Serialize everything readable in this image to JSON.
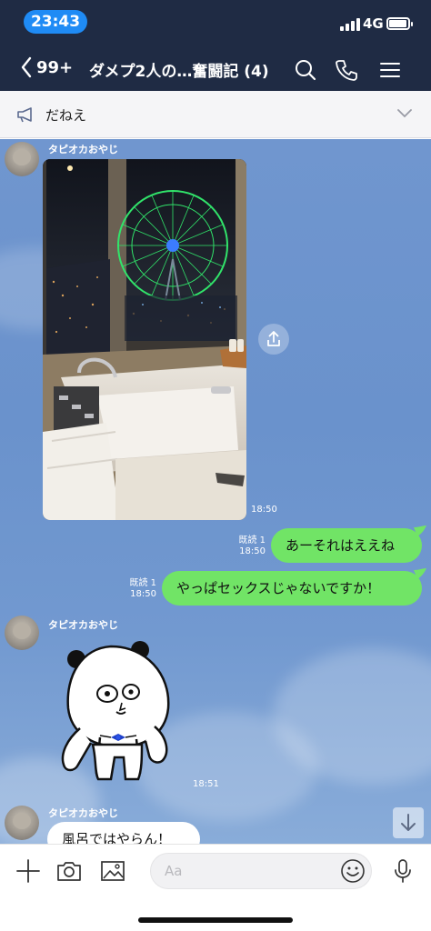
{
  "status_bar": {
    "time": "23:43",
    "network": "4G"
  },
  "header": {
    "back_count": "99+",
    "title": "ダメプ2人の…奮闘記 (4)"
  },
  "announcement": {
    "text": "だねえ"
  },
  "messages": [
    {
      "type": "image",
      "sender": "タピオカおやじ",
      "time": "18:50"
    },
    {
      "type": "text",
      "from": "me",
      "read": "既読 1",
      "time": "18:50",
      "text": "あーそれはええね"
    },
    {
      "type": "text",
      "from": "me",
      "read": "既読 1",
      "time": "18:50",
      "text": "やっぱセックスじゃないですか！"
    },
    {
      "type": "sticker",
      "sender": "タピオカおやじ",
      "time": "18:51"
    },
    {
      "type": "text",
      "sender": "タピオカおやじ",
      "text": "風呂ではやらん！"
    }
  ],
  "input": {
    "placeholder": "Aa"
  },
  "colors": {
    "header": "#1f2b44",
    "my_bubble": "#71e466",
    "chat_bg": "#7096cf",
    "time_pill": "#1f8bf5"
  }
}
